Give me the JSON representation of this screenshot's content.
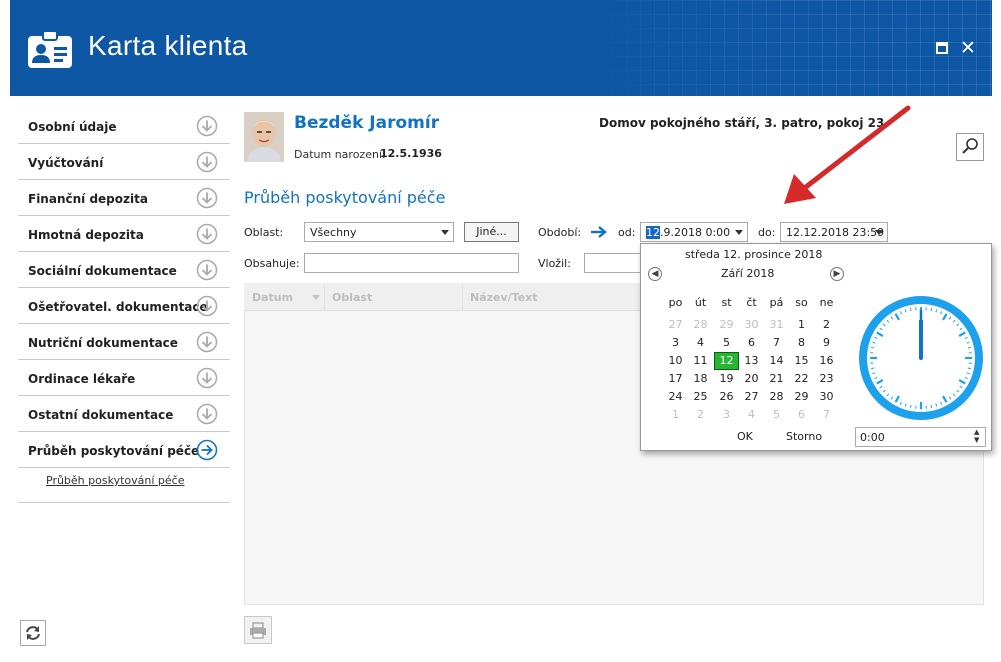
{
  "app": {
    "title": "Karta klienta"
  },
  "sidebar": {
    "items": [
      {
        "label": "Osobní údaje"
      },
      {
        "label": "Vyúčtování"
      },
      {
        "label": "Finanční depozita"
      },
      {
        "label": "Hmotná depozita"
      },
      {
        "label": "Sociální dokumentace"
      },
      {
        "label": "Ošetřovatel. dokumentace"
      },
      {
        "label": "Nutriční dokumentace"
      },
      {
        "label": "Ordinace lékaře"
      },
      {
        "label": "Ostatní dokumentace"
      },
      {
        "label": "Průběh poskytování péče"
      }
    ],
    "active_index": 9,
    "sub_link": "Průběh poskytování péče"
  },
  "client": {
    "name": "Bezděk Jaromír",
    "dob_label": "Datum narození:",
    "dob": "12.5.1936",
    "location": "Domov pokojného stáří, 3. patro, pokoj 23"
  },
  "section": {
    "title": "Průběh poskytování péče"
  },
  "filters": {
    "oblast_label": "Oblast:",
    "oblast_value": "Všechny",
    "jine_label": "Jiné...",
    "obdobi_label": "Období:",
    "od_label": "od:",
    "od_selected": "12",
    "od_rest": ".9.2018 0:00",
    "do_label": "do:",
    "do_value": "12.12.2018 23:59",
    "obsahuje_label": "Obsahuje:",
    "obsahuje_value": "",
    "vlozil_label": "Vložil:",
    "vlozil_value": ""
  },
  "grid": {
    "columns": [
      "Datum",
      "Oblast",
      "Název/Text"
    ]
  },
  "calendar": {
    "today_label": "středa 12. prosince 2018",
    "month_label": "Září 2018",
    "weekdays": [
      "po",
      "út",
      "st",
      "čt",
      "pá",
      "so",
      "ne"
    ],
    "weeks": [
      [
        {
          "d": "27",
          "o": true
        },
        {
          "d": "28",
          "o": true
        },
        {
          "d": "29",
          "o": true
        },
        {
          "d": "30",
          "o": true
        },
        {
          "d": "31",
          "o": true
        },
        {
          "d": "1"
        },
        {
          "d": "2"
        }
      ],
      [
        {
          "d": "3"
        },
        {
          "d": "4"
        },
        {
          "d": "5"
        },
        {
          "d": "6"
        },
        {
          "d": "7"
        },
        {
          "d": "8"
        },
        {
          "d": "9"
        }
      ],
      [
        {
          "d": "10"
        },
        {
          "d": "11"
        },
        {
          "d": "12",
          "sel": true
        },
        {
          "d": "13"
        },
        {
          "d": "14"
        },
        {
          "d": "15"
        },
        {
          "d": "16"
        }
      ],
      [
        {
          "d": "17"
        },
        {
          "d": "18"
        },
        {
          "d": "19"
        },
        {
          "d": "20"
        },
        {
          "d": "21"
        },
        {
          "d": "22"
        },
        {
          "d": "23"
        }
      ],
      [
        {
          "d": "24"
        },
        {
          "d": "25"
        },
        {
          "d": "26"
        },
        {
          "d": "27"
        },
        {
          "d": "28"
        },
        {
          "d": "29"
        },
        {
          "d": "30"
        }
      ],
      [
        {
          "d": "1",
          "o": true
        },
        {
          "d": "2",
          "o": true
        },
        {
          "d": "3",
          "o": true
        },
        {
          "d": "4",
          "o": true
        },
        {
          "d": "5",
          "o": true
        },
        {
          "d": "6",
          "o": true
        },
        {
          "d": "7",
          "o": true
        }
      ]
    ],
    "ok_label": "OK",
    "storno_label": "Storno",
    "time_value": "0:00"
  },
  "colors": {
    "header": "#0e57a4",
    "accent": "#1173c2",
    "selected_day": "#27b534",
    "annotation_arrow": "#d62a2a"
  },
  "icons": {
    "app": "id-card-icon",
    "nav": "arrow-down-circle-icon",
    "nav_active": "arrow-right-circle-icon",
    "search": "magnifier-icon",
    "refresh": "refresh-icon",
    "print": "print-icon",
    "close": "close-icon",
    "maximize": "maximize-icon"
  }
}
